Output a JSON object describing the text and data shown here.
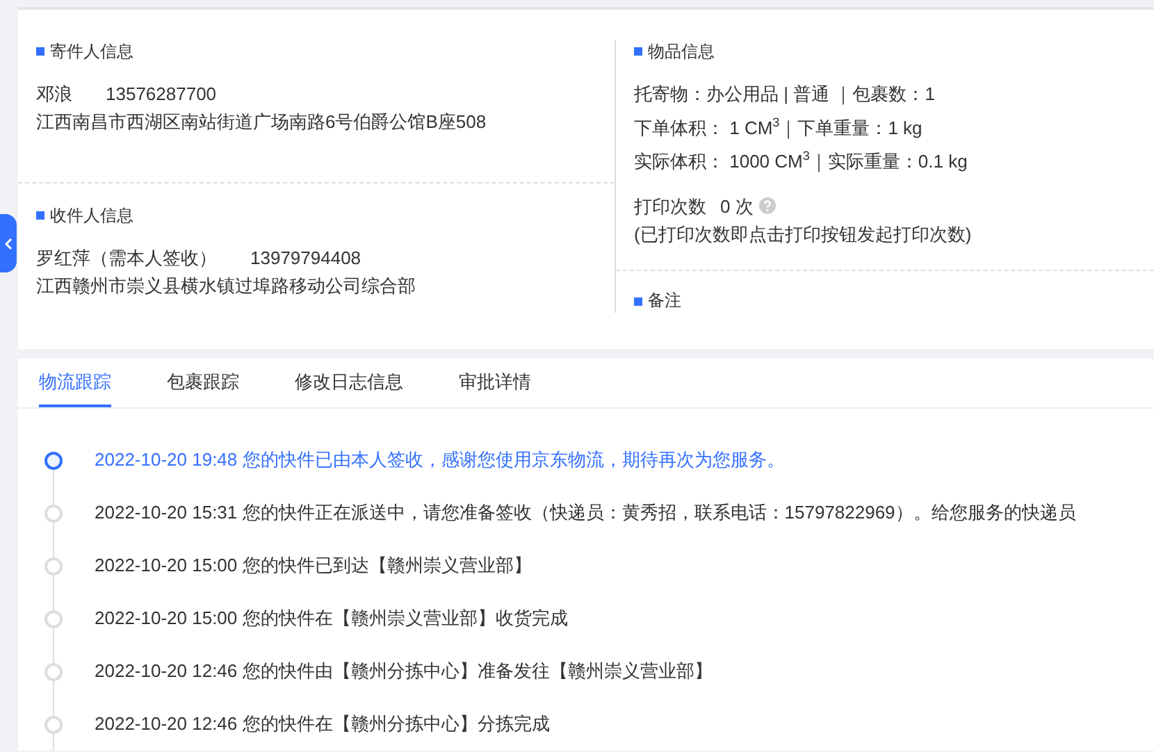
{
  "sender": {
    "title": "寄件人信息",
    "name": "邓浪",
    "phone": "13576287700",
    "address": "江西南昌市西湖区南站街道广场南路6号伯爵公馆B座508"
  },
  "receiver": {
    "title": "收件人信息",
    "name": "罗红萍（需本人签收）",
    "phone": "13979794408",
    "address": "江西赣州市崇义县横水镇过埠路移动公司综合部"
  },
  "goods": {
    "title": "物品信息",
    "lines": [
      "托寄物：办公用品 | 普通 ｜包裹数：1",
      "下单体积：  1 CM$^{3}$｜下单重量：1 kg",
      "实际体积：  1000 CM$^{3}$｜实际重量：0.1 kg"
    ],
    "print_count_label": "打印次数",
    "print_count": "0 次",
    "print_note": "(已打印次数即点击打印按钮发起打印次数)"
  },
  "remark": {
    "title": "备注"
  },
  "tabs": [
    {
      "label": "物流跟踪",
      "selected": true
    },
    {
      "label": "包裹跟踪",
      "selected": false
    },
    {
      "label": "修改日志信息",
      "selected": false
    },
    {
      "label": "审批详情",
      "selected": false
    }
  ],
  "timeline": [
    {
      "text": "2022-10-20 19:48 您的快件已由本人签收，感谢您使用京东物流，期待再次为您服务。",
      "selected": true
    },
    {
      "text": "2022-10-20 15:31 您的快件正在派送中，请您准备签收（快递员：黄秀招，联系电话：15797822969）。给您服务的快递员",
      "selected": false
    },
    {
      "text": "2022-10-20 15:00 您的快件已到达【赣州崇义营业部】",
      "selected": false
    },
    {
      "text": "2022-10-20 15:00 您的快件在【赣州崇义营业部】收货完成",
      "selected": false
    },
    {
      "text": "2022-10-20 12:46 您的快件由【赣州分拣中心】准备发往【赣州崇义营业部】",
      "selected": false
    },
    {
      "text": "2022-10-20 12:46 您的快件在【赣州分拣中心】分拣完成",
      "selected": false
    }
  ]
}
